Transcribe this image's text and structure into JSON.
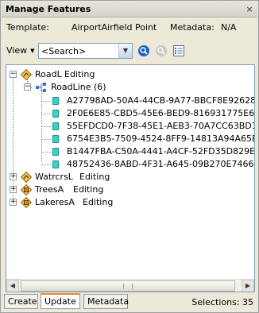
{
  "window": {
    "title": "Manage Features",
    "close_glyph": "×"
  },
  "template": {
    "label": "Template:",
    "value": "AirportAirfield Point",
    "metadata_label": "Metadata:",
    "metadata_value": "N/A"
  },
  "toolbar": {
    "view_label": "View",
    "search_value": "<Search>",
    "icons": [
      "search-icon",
      "clear-search-icon",
      "list-view-icon"
    ]
  },
  "tree": {
    "layers": [
      {
        "name": "RoadL",
        "status": "Editing",
        "expanded": true
      },
      {
        "name": "WatrcrsL",
        "status": "Editing",
        "expanded": false
      },
      {
        "name": "TreesA",
        "status": "Editing",
        "expanded": false
      },
      {
        "name": "LakeresA",
        "status": "Editing",
        "expanded": false
      }
    ],
    "subtype": {
      "name": "RoadLine",
      "count": "(6)"
    },
    "features": [
      "A27798AD-50A4-44CB-9A77-BBCF8E92628",
      "2F0E6E85-CBD5-45E6-BED9-816931775E6",
      "55EFDCD0-7F38-45E1-AEB3-70A7CC63BD1",
      "6754E3B5-7509-4524-8FF9-14813A94A65E",
      "B1447FBA-C50A-4441-A4CF-52FD35D829E",
      "48752436-8ABD-4F31-A645-09B270E74666"
    ]
  },
  "tabs": [
    {
      "label": "Create",
      "active": false
    },
    {
      "label": "Update",
      "active": true
    },
    {
      "label": "Metadata",
      "active": false
    }
  ],
  "status": {
    "selections": "Selections: 35"
  },
  "colors": {
    "active_tab_accent": "#e68b2c",
    "feature_icon": "#33d6c6",
    "search_icon": "#1e63c6"
  }
}
